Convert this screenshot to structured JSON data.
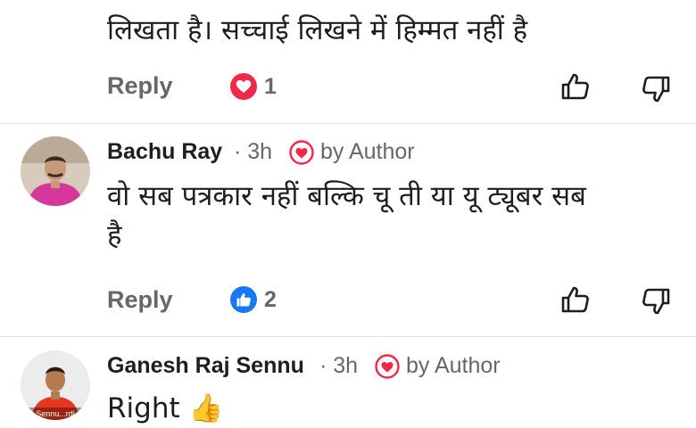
{
  "comments": [
    {
      "text": "लिखता है। सच्चाई लिखने में हिम्मत नहीं है",
      "reply_label": "Reply",
      "reaction": "love",
      "reaction_count": "1"
    },
    {
      "author": "Bachu Ray",
      "time": "· 3h",
      "badge": "by Author",
      "text_line1": "वो सब पत्रकार नहीं बल्कि चू ती या यू ट्यूबर सब",
      "text_line2": "है",
      "reply_label": "Reply",
      "reaction": "like",
      "reaction_count": "2"
    },
    {
      "author": "Ganesh Raj Sennu",
      "time": "· 3h",
      "badge": "by Author",
      "text": "Right 👍",
      "avatar_caption": "Sennu...rdj"
    }
  ],
  "colors": {
    "love": "#f02849",
    "like": "#1877f2",
    "secondary_text": "#65676b",
    "primary_text": "#1c1e21"
  },
  "icons": [
    "heart-icon",
    "thumbs-up-icon",
    "thumbs-down-icon"
  ]
}
